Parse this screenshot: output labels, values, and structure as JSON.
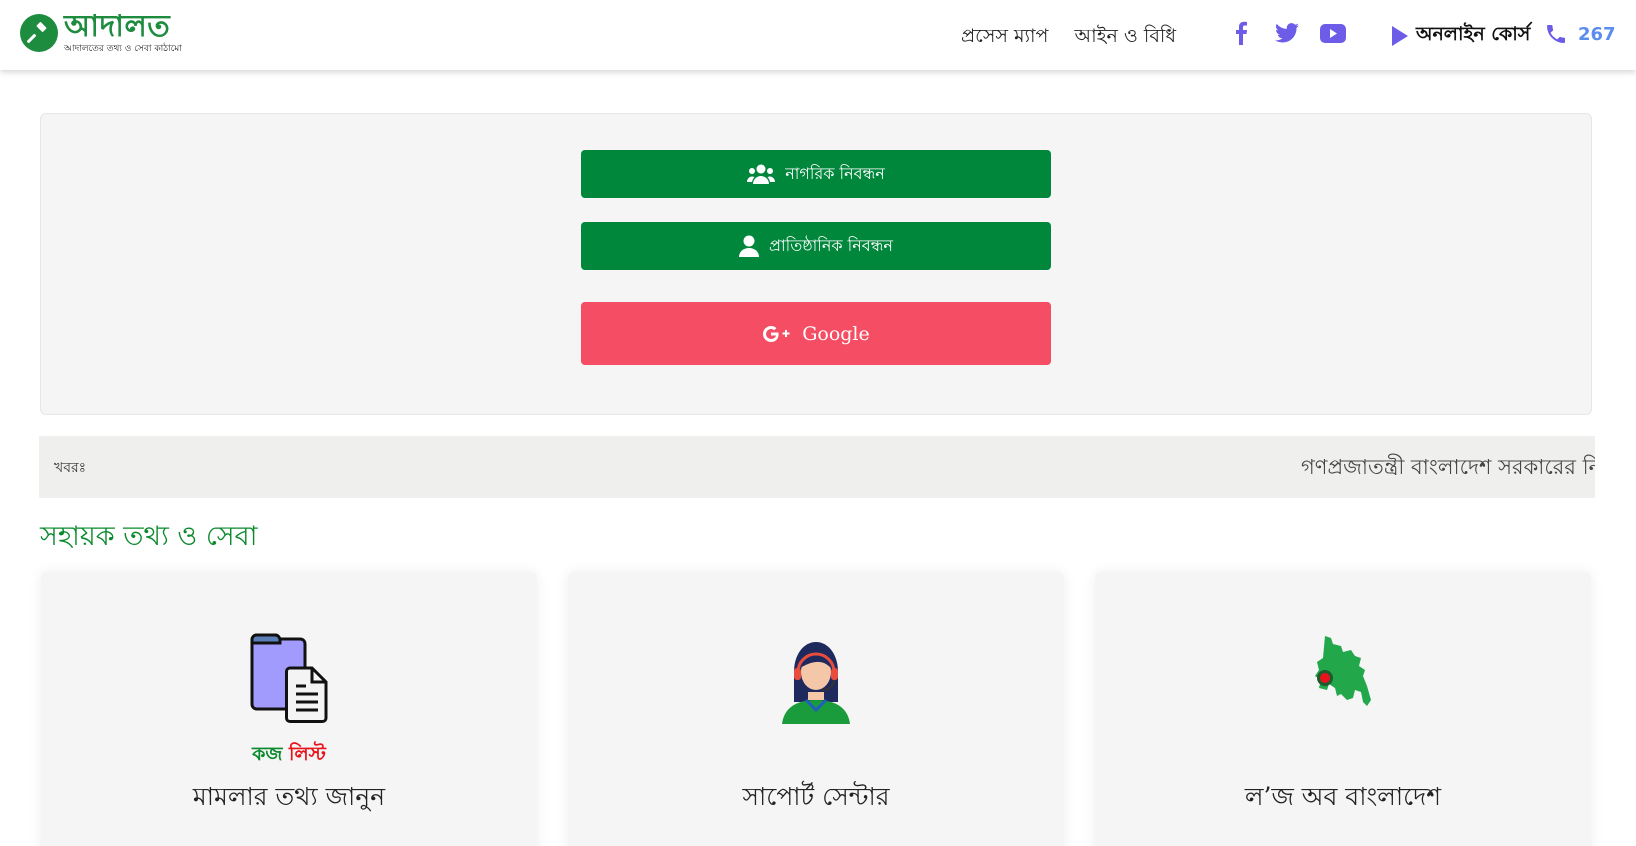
{
  "header": {
    "logo_title": "আদালত",
    "logo_subtitle": "আদালতের তথ্য ও সেবা কাঠামো",
    "nav": [
      "প্রসেস ম্যাপ",
      "আইন ও বিধি"
    ],
    "social_icons": [
      "facebook-icon",
      "twitter-icon",
      "youtube-icon"
    ],
    "online_course": "অনলাইন কোর্স",
    "phone_number": "267"
  },
  "registration": {
    "citizen_label": "নাগরিক নিবন্ধন",
    "organization_label": "প্রাতিষ্ঠানিক নিবন্ধন",
    "google_label": "Google"
  },
  "ticker": {
    "label": "খবরঃ",
    "text": "গণপ্রজাতন্ত্রী বাংলাদেশ সরকারের নি"
  },
  "section": {
    "title": "সহায়ক তথ্য ও সেবা"
  },
  "cards": [
    {
      "badge_green": "কজ",
      "badge_red": "লিস্ট",
      "title": "মামলার তথ্য জানুন",
      "icon": "folder-document-icon"
    },
    {
      "title": "সাপোর্ট সেন্টার",
      "icon": "support-agent-icon"
    },
    {
      "title": "ল’জ অব বাংলাদেশ",
      "icon": "bangladesh-map-icon"
    }
  ],
  "colors": {
    "brand_green": "#00873c",
    "google_red": "#f54d63",
    "accent_purple": "#6c5ce7",
    "phone_blue": "#5b8def"
  }
}
